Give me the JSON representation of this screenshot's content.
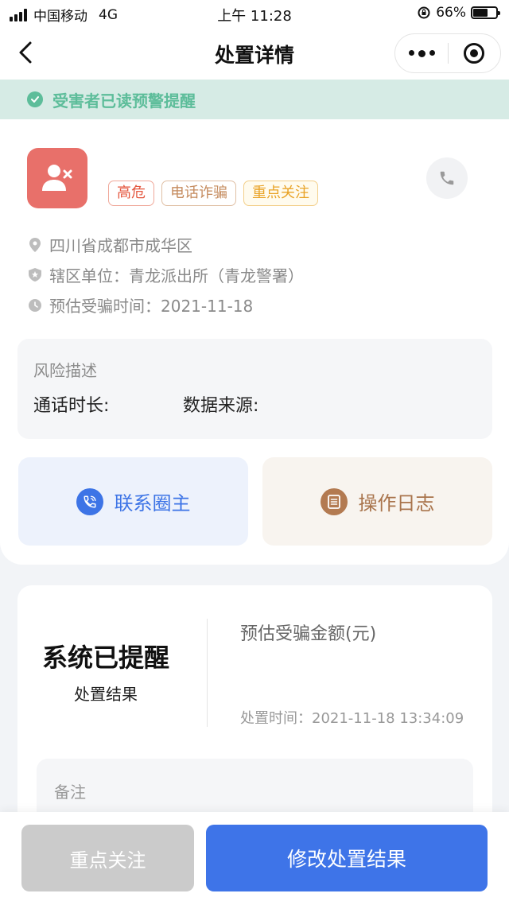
{
  "status_bar": {
    "carrier": "中国移动",
    "network": "4G",
    "time": "上午 11:28",
    "battery_text": "66%",
    "battery_level_percent": 66
  },
  "nav": {
    "title": "处置详情",
    "icons": [
      "back-chevron-icon",
      "more-dots-icon",
      "close-target-icon"
    ]
  },
  "notice": {
    "text": "受害者已读预警提醒",
    "color": "#5dbd9a"
  },
  "profile": {
    "avatar_icon": "user-remove-icon",
    "avatar_color": "#e8706a",
    "tags": [
      {
        "label": "高危"
      },
      {
        "label": "电话诈骗"
      },
      {
        "label": "重点关注"
      }
    ],
    "phone_icon": "phone-icon"
  },
  "info": {
    "location": "四川省成都市成华区",
    "jurisdiction": "辖区单位：青龙派出所（青龙警署）",
    "fraud_time": "预估受骗时间：2021-11-18"
  },
  "risk": {
    "title": "风险描述",
    "call_duration_label": "通话时长:",
    "data_source_label": "数据来源:"
  },
  "actions": {
    "contact_label": "联系圈主",
    "log_label": "操作日志",
    "contact_color": "#3d74e6",
    "log_color": "#a9744c"
  },
  "result": {
    "status": "系统已提醒",
    "status_label": "处置结果",
    "amount_label": "预估受骗金额(元)",
    "time_text": "处置时间：2021-11-18 13:34:09",
    "remark_title": "备注"
  },
  "bottom": {
    "focus_label": "重点关注",
    "modify_label": "修改处置结果",
    "primary_color": "#3e74e8"
  }
}
